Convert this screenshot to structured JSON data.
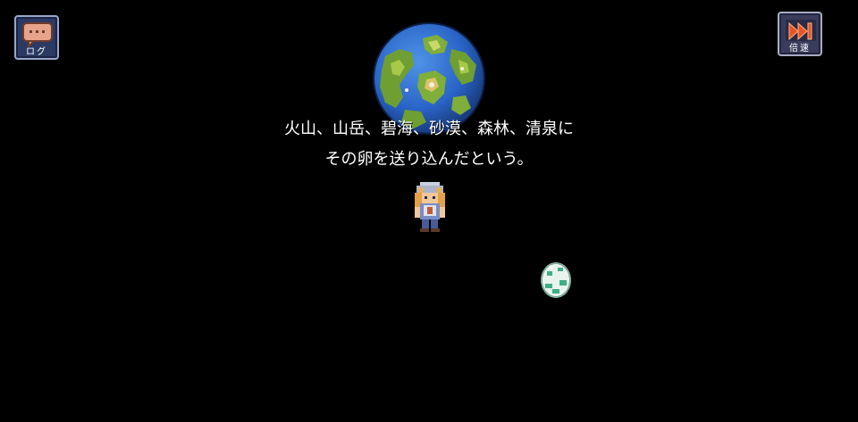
{
  "hud": {
    "log_button": {
      "label": "ログ",
      "icon": "speech-bubble-icon"
    },
    "speed_button": {
      "label": "倍速",
      "icon": "fast-forward-icon"
    }
  },
  "narration": {
    "lines": [
      "火山、山岳、碧海、砂漠、森林、清泉に",
      "その卵を送り込んだという。"
    ]
  },
  "colors": {
    "background": "#000000",
    "text": "#ffffff",
    "log_button_bg": "#2b3a63",
    "speed_button_icon": "#e8532b",
    "ocean": "#2a64c8",
    "land": "#7fae3a",
    "egg": "#e9f3ee",
    "egg_spots": "#3fae86"
  },
  "sprites": {
    "globe": "world-globe",
    "hero": "hero-character-sprite",
    "egg": "dragon-egg-sprite"
  }
}
